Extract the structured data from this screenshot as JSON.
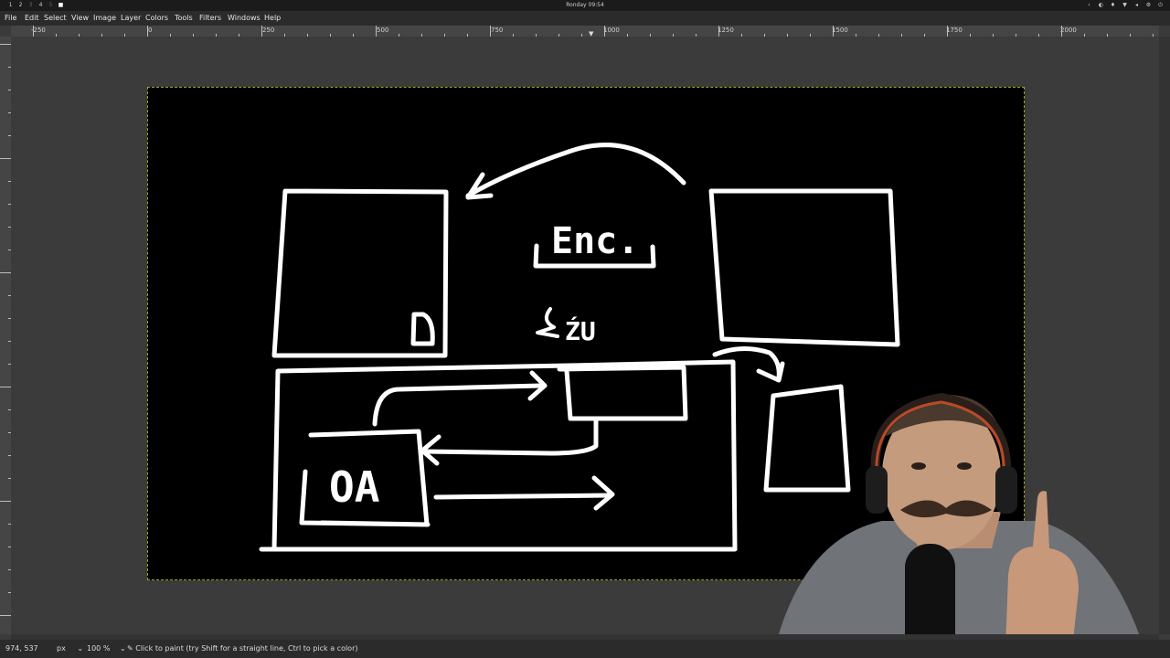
{
  "system_bar": {
    "workspaces": [
      "1",
      "2",
      "3",
      "4",
      "5"
    ],
    "clock": "Ronday 09:54"
  },
  "menu": {
    "items": [
      "File",
      "Edit",
      "Select",
      "View",
      "Image",
      "Layer",
      "Colors",
      "Tools",
      "Filters",
      "Windows",
      "Help"
    ]
  },
  "ruler": {
    "labels": [
      "-250",
      "0",
      "250",
      "500",
      "750",
      "1000",
      "1250",
      "1500",
      "1750",
      "2000"
    ]
  },
  "canvas": {
    "drawn_text": {
      "enc": "Enc.",
      "oa": "OA",
      "d": "D",
      "zu": "ŹU"
    }
  },
  "status": {
    "coordinates": "974, 537",
    "unit": "px",
    "zoom": "100 %",
    "hint": "Click to paint (try Shift for a straight line, Ctrl to pick a color)"
  },
  "colors": {
    "canvas_bg": "#000000",
    "stroke": "#ffffff",
    "ui_bg": "#3b3b3b",
    "selection_border": "#a3a323"
  }
}
